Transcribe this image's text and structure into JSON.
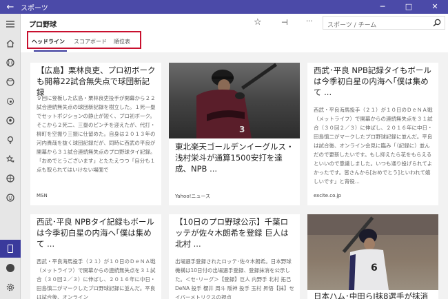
{
  "titlebar": {
    "title": "スポーツ",
    "back": "←",
    "minimize": "─",
    "maximize": "□",
    "close": "✕"
  },
  "header": {
    "page_title": "プロ野球",
    "star": "☆",
    "pin": "⊣",
    "more": "···",
    "search_placeholder": "スポーツ / チーム"
  },
  "tabs": [
    "ヘッドライン",
    "スコアボード",
    "順位表"
  ],
  "sidebar_icons": [
    "hamburger-icon",
    "home-icon",
    "baseball-icon",
    "tennis-icon",
    "golf-icon",
    "soccer-icon",
    "lightbulb-icon",
    "stars-icon",
    "basketball-icon",
    "smiley-icon",
    "phone-icon",
    "account-icon",
    "settings-icon"
  ],
  "cards": [
    {
      "title": "【広島】栗林良吏、プロ初ボークも開幕22試合無失点で球団新記録",
      "body": "９回に登板した広島・栗林良吏投手が開幕から２２試合連続無失点の球団新記録を樹立した。１死一塁でセットポジションの静止が短く、プロ初ボーク。そこから２死二、三塁のピンチを迎えたが、代打・柳町を空振り三振に仕留めた。自身は２０１３年の河内貴哉を抜く球団記録だが、同時に西武の平良が開幕から３１試合連続無失点のプロ野球タイ記録。「おめでとうございます」とたたえつつ「自分も１点も取られてはいけない場面で",
      "source": "MSN"
    },
    {
      "title": "東北楽天ゴールデンイーグルス・浅村栄斗が通算1500安打を達成、NPB ...",
      "source": "Yahoo!ニュース",
      "jersey": "3"
    },
    {
      "title": "西武･平良 NPB記録タイもボールは今季初白星の内海へ｢僕は集めて ...",
      "body": "西武・平良海馬投手（２１）が１０日のＤｅＮＡ戦（メットライフ）で開幕からの連続無失点を３１試合（３０回２／３）に伸ばし、２０１６年に中日・田島慎二がマークしたプロ野球記録に並んだ。平良は試合後、オンライン会見に臨み「（記録に）並んだので更新したいです。もし抑えたら花をもらえるといいので意識しました。いつも通り投げられてよかったです。皆さんから[おめでとう]といわれて嬉しいです」と背役...",
      "source": "excite.co.jp"
    },
    {
      "title": "西武･平良 NPBタイ記録もボールは今季初白星の内海へ｢僕は集めて ...",
      "body": "西武・平良海馬投手（２１）が１０日のＤｅＮＡ戦（メットライフ）で開幕からの連続無失点を３１試合（３０回２／３）に伸ばし、２０１６年に中日・田島慎二がマークしたプロ野球記録に並んだ。平良は試合後、オンライン"
    },
    {
      "title": "【10日のプロ野球公示】千葉ロッテが佐々木朗希を登録 巨人は北村 ...",
      "body": "出場選手登録されたロッテ･佐々木朗希。日本野球機構は10日付の出場選手登録、登録抹消を公示した。＜セ･リーグ＞【登録】巨人 内野手 北村 拓己 DeNA 投手 櫻井 周斗 阪神 投手 玉村 昇悟【抹】セイバーメトリクスの視点"
    },
    {
      "title": "日本ハム･中田らJ抹8選手が抹消 ...",
      "jersey": "6"
    }
  ]
}
